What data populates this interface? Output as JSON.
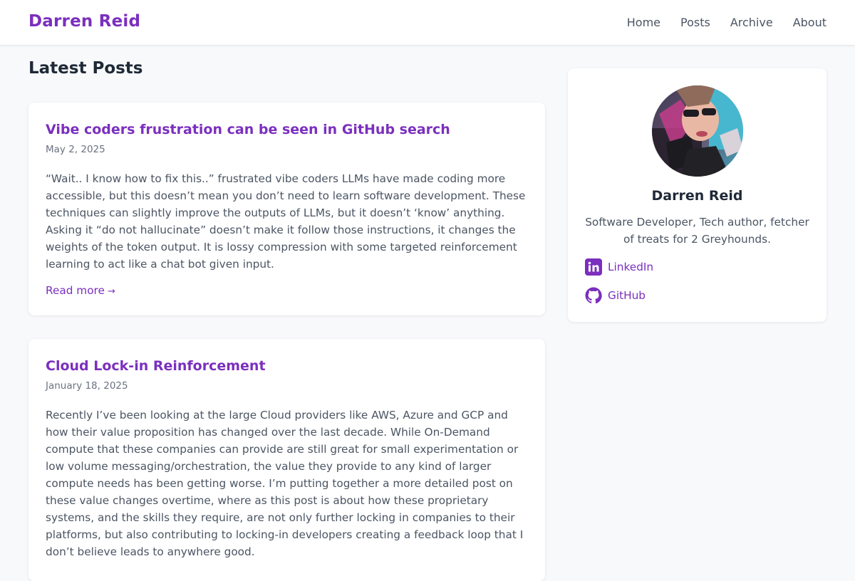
{
  "header": {
    "site_title": "Darren Reid",
    "nav": [
      "Home",
      "Posts",
      "Archive",
      "About"
    ]
  },
  "main": {
    "section_title": "Latest Posts",
    "posts": [
      {
        "title": "Vibe coders frustration can be seen in GitHub search",
        "date": "May 2, 2025",
        "excerpt": "“Wait.. I know how to fix this..” frustrated vibe coders LLMs have made coding more accessible, but this doesn’t mean you don’t need to learn software development. These techniques can slightly improve the outputs of LLMs, but it doesn’t ‘know’ anything. Asking it “do not hallucinate” doesn’t make it follow those instructions, it changes the weights of the token output. It is lossy compression with some targeted reinforcement learning to act like a chat bot given input.",
        "read_more": "Read more",
        "read_more_arrow": "→"
      },
      {
        "title": "Cloud Lock-in Reinforcement",
        "date": "January 18, 2025",
        "excerpt": "Recently I’ve been looking at the large Cloud providers like AWS, Azure and GCP and how their value proposition has changed over the last decade. While On-Demand compute that these companies can provide are still great for small experimentation or low volume messaging/orchestration, the value they provide to any kind of larger compute needs has been getting worse. I’m putting together a more detailed post on these value changes overtime, where as this post is about how these proprietary systems, and the skills they require, are not only further locking in companies to their platforms, but also contributing to locking-in developers creating a feedback loop that I don’t believe leads to anywhere good."
      }
    ]
  },
  "sidebar": {
    "name": "Darren Reid",
    "bio": "Software Developer, Tech author, fetcher of treats for 2 Greyhounds.",
    "links": [
      {
        "label": "LinkedIn",
        "icon": "linkedin-icon"
      },
      {
        "label": "GitHub",
        "icon": "github-icon"
      }
    ]
  },
  "colors": {
    "accent": "#7b2fbe",
    "background": "#f8f9fb",
    "card": "#ffffff",
    "text": "#4b5563"
  }
}
